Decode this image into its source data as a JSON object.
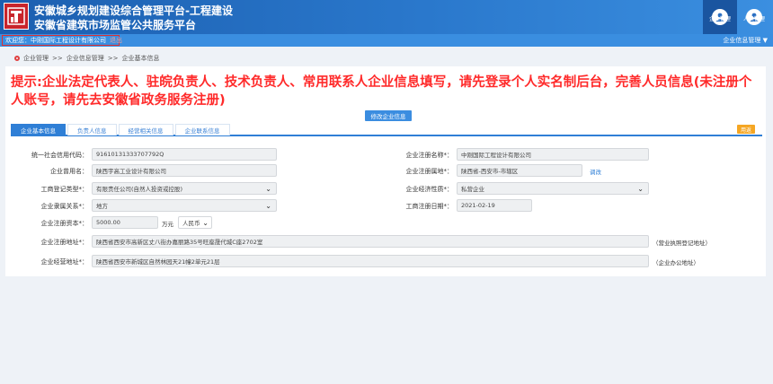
{
  "header": {
    "title_line1": "安徽城乡规划建设综合管理平台-工程建设",
    "title_line2": "安徽省建筑市场监管公共服务平台",
    "buttons": [
      {
        "label": "企业管理",
        "icon": "enterprise-user-icon"
      },
      {
        "label": "人员管理",
        "icon": "person-icon"
      }
    ]
  },
  "welcome_bar": {
    "welcome_text": "欢迎您：中刚国际工程设计有限公司",
    "close_text": "退出",
    "menu_label": "企业信息管理 ▼"
  },
  "breadcrumb": [
    "企业管理",
    ">>",
    "企业信息管理",
    ">>",
    "企业基本信息"
  ],
  "notice": "提示:企业法定代表人、驻皖负责人、技术负责人、常用联系人企业信息填写，请先登录个人实名制后台，完善人员信息(未注册个人账号，请先去安徽省政务服务注册)",
  "modify_button": "修改企业信息",
  "tabs": [
    "企业基本信息",
    "负责人信息",
    "经营相关信息",
    "企业联系信息"
  ],
  "return_button": "用返",
  "form": {
    "credit_code": {
      "label": "统一社会信用代码：",
      "value": "91610131333707792Q"
    },
    "reg_name": {
      "label": "企业注册名称*：",
      "value": "中刚国际工程设计有限公司"
    },
    "used_name": {
      "label": "企业曾用名：",
      "value": "陕西宇高工业设计有限公司"
    },
    "reg_place": {
      "label": "企业注册属地*：",
      "value": "陕西省-西安市-市辖区",
      "link": "调改"
    },
    "biz_type": {
      "label": "工商登记类型*：",
      "value": "有限责任公司(自然人投资或控股)"
    },
    "econ_nature": {
      "label": "企业经济性质*：",
      "value": "私营企业"
    },
    "affiliation": {
      "label": "企业隶属关系*：",
      "value": "地方"
    },
    "reg_date": {
      "label": "工商注册日期*：",
      "value": "2021-02-19"
    },
    "capital": {
      "label": "企业注册资本*：",
      "value": "5000.00",
      "unit": "万元",
      "currency": "人民币"
    },
    "reg_address": {
      "label": "企业注册地址*：",
      "value": "陕西省西安市高新区丈八街办嘉丽路35号旺座晟代城C座2702室",
      "note": "（营业执照登记地址）"
    },
    "op_address": {
      "label": "企业经营地址*：",
      "value": "陕西省西安市新城区自然林园天21幢2单元21层",
      "note": "（企业办公地址）"
    }
  }
}
